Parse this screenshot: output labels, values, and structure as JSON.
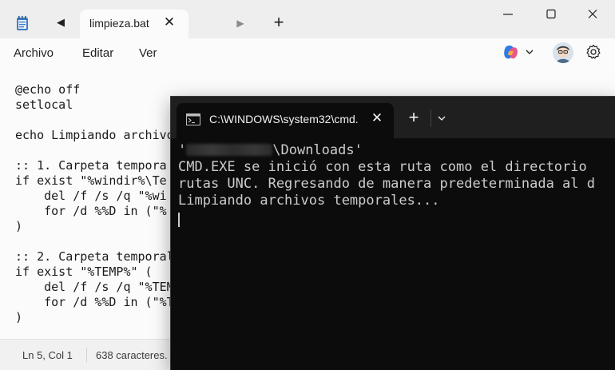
{
  "notepad": {
    "tab_title": "limpieza.bat",
    "menu": [
      "Archivo",
      "Editar",
      "Ver"
    ],
    "code_lines": [
      "@echo off",
      "setlocal",
      "",
      "echo Limpiando archivo",
      "",
      ":: 1. Carpeta tempora",
      "if exist \"%windir%\\Te",
      "    del /f /s /q \"%wi",
      "    for /d %%D in (\"%",
      ")",
      "",
      ":: 2. Carpeta temporal",
      "if exist \"%TEMP%\" (",
      "    del /f /s /q \"%TEM",
      "    for /d %%D in (\"%T",
      ")"
    ],
    "status_position": "Ln 5, Col 1",
    "status_chars": "638 caracteres."
  },
  "terminal": {
    "tab_title": "C:\\WINDOWS\\system32\\cmd.",
    "lines": {
      "path_open": "'",
      "path_rest": "\\Downloads'",
      "l2": "CMD.EXE se inició con esta ruta como el directorio",
      "l3": "rutas UNC. Regresando de manera predeterminada al d",
      "l4": "Limpiando archivos temporales..."
    }
  },
  "colors": {
    "notepad_bg": "#fbfbfb",
    "notepad_titlebar": "#eeeeee",
    "terminal_bg": "#0c0c0c",
    "terminal_titlebar": "#1f1f1f",
    "terminal_text": "#cccccc"
  }
}
